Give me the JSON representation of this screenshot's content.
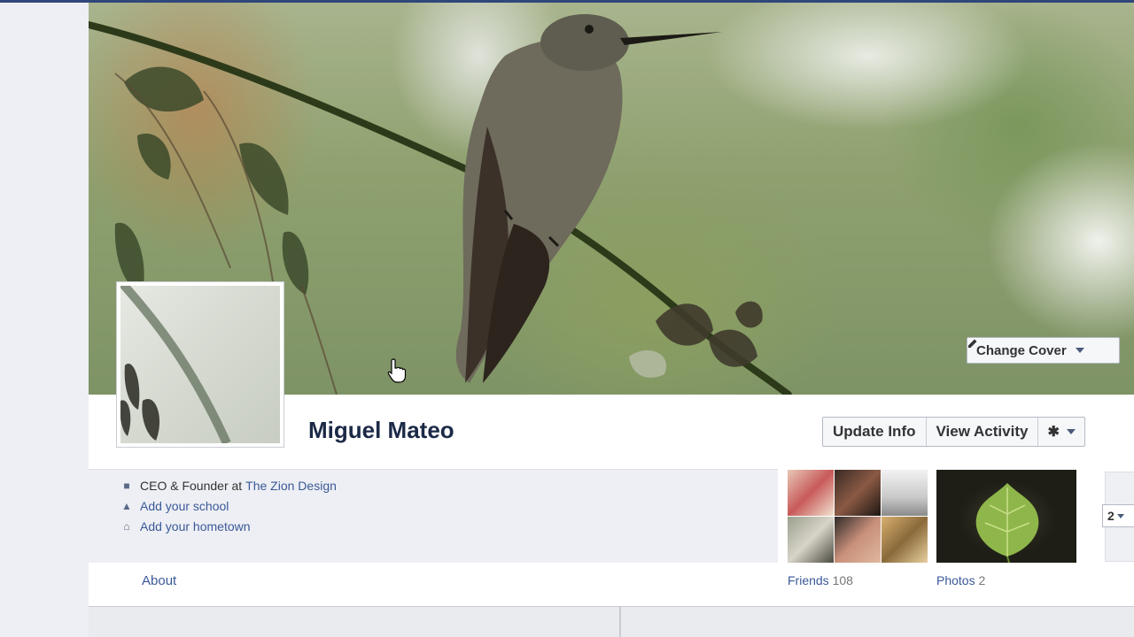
{
  "profile": {
    "name": "Miguel Mateo",
    "change_cover_label": "Change Cover"
  },
  "actions": {
    "update_info": "Update Info",
    "view_activity": "View Activity"
  },
  "info": {
    "work_role": "CEO & Founder at",
    "work_company": "The Zion Design",
    "school_link": "Add your school",
    "hometown_link": "Add your hometown"
  },
  "nav": {
    "about": "About"
  },
  "apps": {
    "friends_label": "Friends",
    "friends_count": "108",
    "photos_label": "Photos",
    "photos_count": "2",
    "more_count": "2"
  },
  "icons": {
    "work": "briefcase-icon",
    "school": "graduation-cap-icon",
    "hometown": "house-icon",
    "edit": "pencil-icon",
    "settings": "gear-icon"
  },
  "colors": {
    "link": "#3b5998",
    "name": "#1c2a47",
    "topbar": "#2f477a"
  }
}
